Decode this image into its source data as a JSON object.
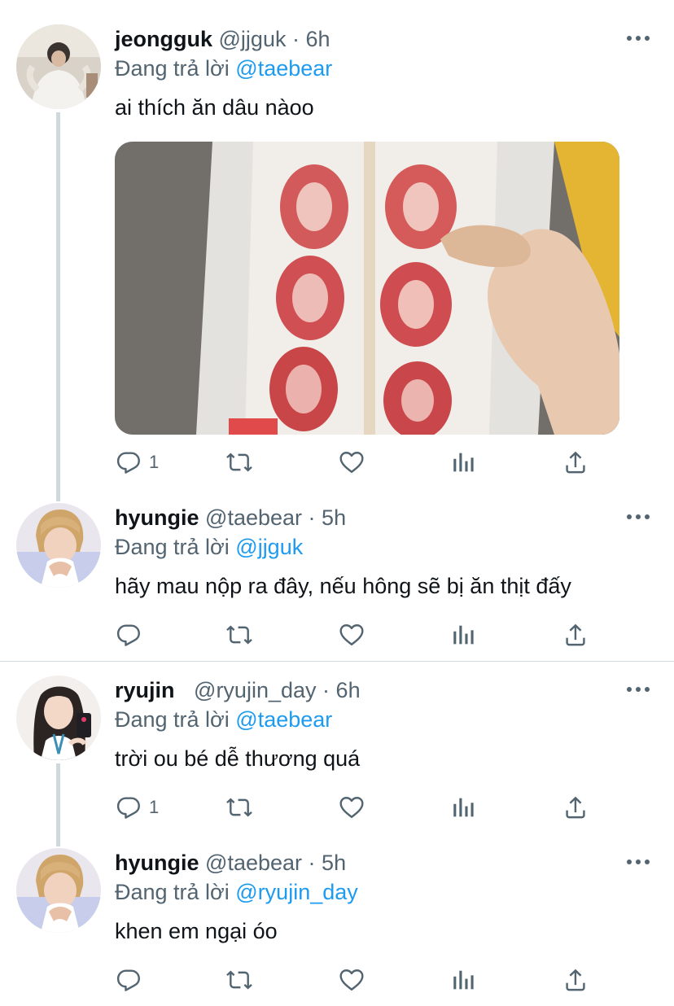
{
  "tweets": [
    {
      "name": "jeongguk",
      "handle": "@jjguk",
      "dot": "·",
      "time": "6h",
      "reply_prefix": "Đang trả lời",
      "reply_to": "@taebear",
      "text": "ai thích ăn dâu nàoo",
      "reply_count": "1"
    },
    {
      "name": "hyungie",
      "handle": "@taebear",
      "dot": "·",
      "time": "5h",
      "reply_prefix": "Đang trả lời",
      "reply_to": "@jjguk",
      "text": "hãy mau nộp ra đây, nếu hông sẽ bị ăn thịt đấy",
      "reply_count": ""
    },
    {
      "name": "ryujin",
      "handle": "@ryujin_day",
      "dot": "·",
      "time": "6h",
      "reply_prefix": "Đang trả lời",
      "reply_to": "@taebear",
      "text": "trời ou bé dễ thương quá",
      "reply_count": "1"
    },
    {
      "name": "hyungie",
      "handle": "@taebear",
      "dot": "·",
      "time": "5h",
      "reply_prefix": "Đang trả lời",
      "reply_to": "@ryujin_day",
      "text": "khen em ngại óo",
      "reply_count": ""
    }
  ],
  "colors": {
    "accent": "#1d9bf0",
    "secondary_text": "#536471",
    "primary_text": "#0f1419",
    "divider": "#cfd9de"
  },
  "icons": [
    "reply-icon",
    "retweet-icon",
    "like-icon",
    "analytics-icon",
    "share-icon",
    "more-icon"
  ]
}
